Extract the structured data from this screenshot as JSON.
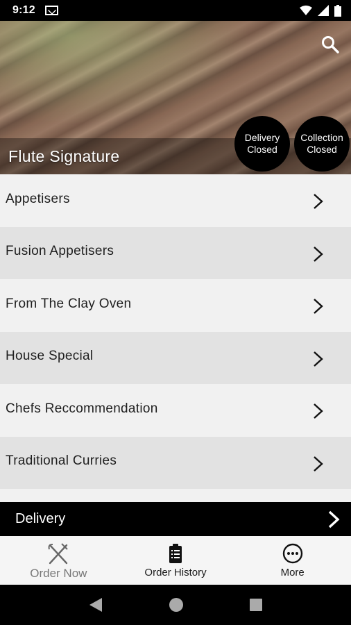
{
  "status_bar": {
    "time": "9:12"
  },
  "hero": {
    "title": "Flute Signature",
    "delivery_status": [
      "Delivery",
      "Closed"
    ],
    "collection_status": [
      "Collection",
      "Closed"
    ]
  },
  "menu": {
    "items": [
      {
        "label": "Appetisers"
      },
      {
        "label": "Fusion Appetisers"
      },
      {
        "label": "From The Clay Oven"
      },
      {
        "label": "House Special"
      },
      {
        "label": "Chefs Reccommendation"
      },
      {
        "label": "Traditional Curries"
      }
    ]
  },
  "delivery_bar": {
    "label": "Delivery"
  },
  "bottom_nav": {
    "order_now": "Order Now",
    "order_history": "Order History",
    "more": "More"
  },
  "colors": {
    "black": "#000000",
    "row_light": "#f1f1f1",
    "row_dark": "#e2e2e2"
  }
}
